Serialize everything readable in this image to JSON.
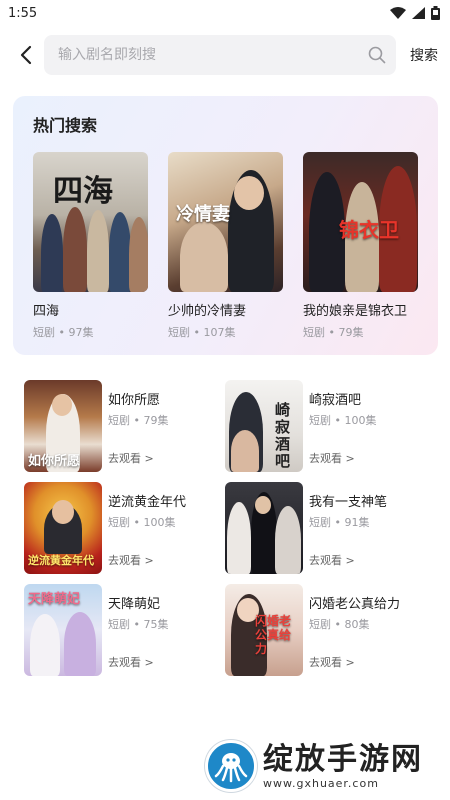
{
  "status": {
    "time": "1:55"
  },
  "search": {
    "placeholder": "输入剧名即刻搜",
    "button": "搜索"
  },
  "hot": {
    "title": "热门搜索",
    "items": [
      {
        "name": "四海",
        "meta": "短剧 • 97集",
        "cover_text": "四海"
      },
      {
        "name": "少帅的冷情妻",
        "meta": "短剧 • 107集",
        "cover_text": "冷情妻"
      },
      {
        "name": "我的娘亲是锦衣卫",
        "meta": "短剧 • 79集",
        "cover_text": "锦衣卫"
      }
    ]
  },
  "list": [
    {
      "name": "如你所愿",
      "meta": "短剧 • 79集",
      "action": "去观看 >",
      "cover_text": "如你所愿"
    },
    {
      "name": "崎寂酒吧",
      "meta": "短剧 • 100集",
      "action": "去观看 >",
      "cover_text": "崎寂酒吧"
    },
    {
      "name": "逆流黄金年代",
      "meta": "短剧 • 100集",
      "action": "去观看 >",
      "cover_text": "逆流黄金年代"
    },
    {
      "name": "我有一支神笔",
      "meta": "短剧 • 91集",
      "action": "去观看 >",
      "cover_text": ""
    },
    {
      "name": "天降萌妃",
      "meta": "短剧 • 75集",
      "action": "去观看 >",
      "cover_text": "天降萌妃"
    },
    {
      "name": "闪婚老公真给力",
      "meta": "短剧 • 80集",
      "action": "去观看 >",
      "cover_text": "闪婚老公真给力"
    }
  ],
  "watermark": {
    "title": "绽放手游网",
    "url": "www.gxhuaer.com"
  },
  "icons": {
    "back": "back-arrow-icon",
    "search": "search-icon",
    "wifi": "wifi-icon",
    "signal": "signal-icon",
    "battery": "battery-icon"
  }
}
